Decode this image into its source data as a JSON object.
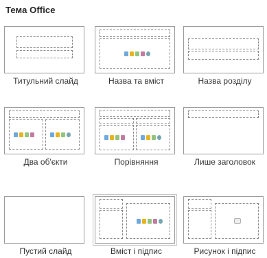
{
  "gallery": {
    "title": "Тема Office",
    "layouts": [
      {
        "label": "Титульний слайд"
      },
      {
        "label": "Назва та вміст"
      },
      {
        "label": "Назва розділу"
      },
      {
        "label": "Два об'єкти"
      },
      {
        "label": "Порівняння"
      },
      {
        "label": "Лише заголовок"
      },
      {
        "label": "Пустий слайд"
      },
      {
        "label": "Вміст і підпис"
      },
      {
        "label": "Рисунок і підпис"
      }
    ],
    "icons": {
      "content_placeholder": "content-placeholder-icon",
      "picture_placeholder": "picture-icon"
    }
  }
}
